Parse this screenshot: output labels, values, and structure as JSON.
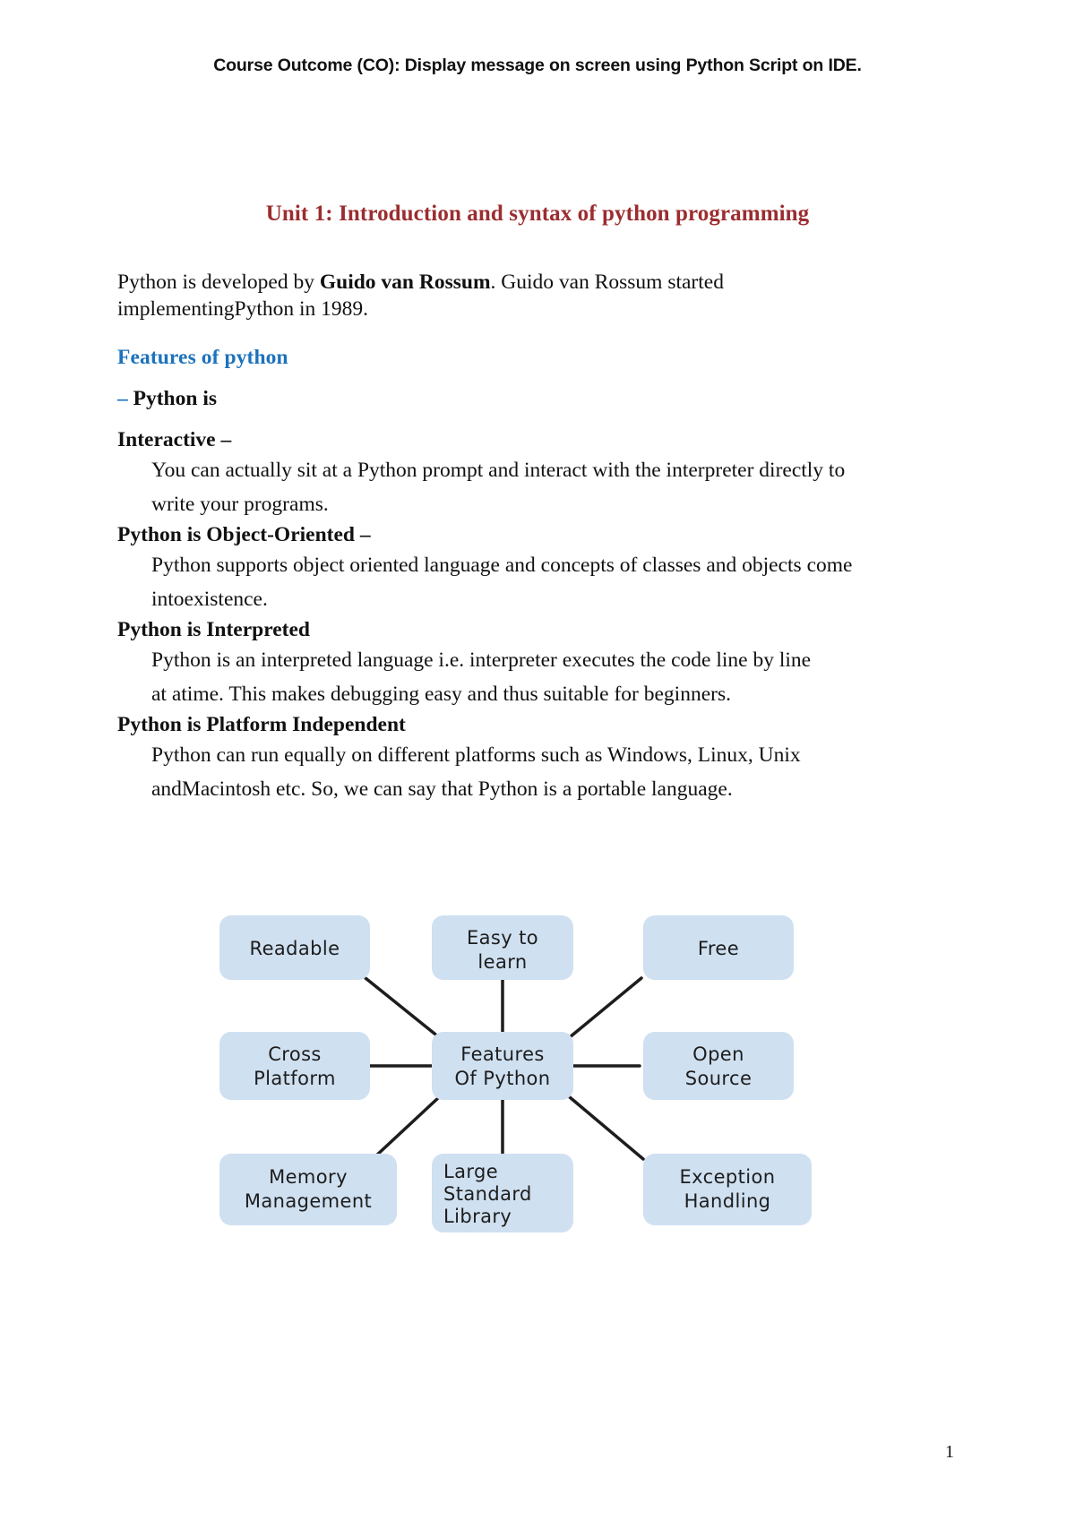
{
  "document": {
    "running_header": "Course Outcome (CO): Display message on screen using Python Script on IDE.",
    "unit_title": "Unit 1: Introduction and syntax of python programming",
    "page_number": "1"
  },
  "colors": {
    "title_red": "#9b2d30",
    "heading_blue": "#1b72bd",
    "node_fill": "#cfe0f1",
    "body_text": "#111111",
    "connector": "#1d1d1d"
  },
  "body": {
    "intro": {
      "line1_before_bold": "Python is developed by ",
      "bold_name": "Guido van Rossum",
      "line1_after_bold": ". Guido van Rossum started",
      "line2": "implementingPython in 1989."
    },
    "features_heading": "Features of python",
    "dash": "– ",
    "python_is": "Python is",
    "sections": [
      {
        "heading": "Interactive –",
        "lines": [
          "You can actually sit at a Python prompt and interact with the interpreter directly to",
          "write your programs."
        ]
      },
      {
        "heading": "Python is Object-Oriented –",
        "lines": [
          "Python supports object oriented language and concepts of classes and objects come",
          "intoexistence."
        ]
      },
      {
        "heading": "Python is Interpreted",
        "lines": [
          "Python is an interpreted language i.e. interpreter executes the code line by line",
          "at atime. This makes debugging easy and thus suitable for beginners."
        ]
      },
      {
        "heading": "Python is Platform Independent",
        "lines": [
          "Python can run equally on different platforms such as Windows, Linux, Unix",
          "andMacintosh  etc. So, we can say that Python is a portable language."
        ]
      }
    ]
  },
  "diagram": {
    "title": "Features Of Python",
    "nodes": {
      "readable": "Readable",
      "easy_to_learn_l1": "Easy to",
      "easy_to_learn_l2": "learn",
      "free": "Free",
      "cross_platform_l1": "Cross",
      "cross_platform_l2": "Platform",
      "center_l1": "Features",
      "center_l2": "Of Python",
      "open_source_l1": "Open",
      "open_source_l2": "Source",
      "memory_management_l1": "Memory",
      "memory_management_l2": "Management",
      "large_std_lib_l1": "Large",
      "large_std_lib_l2": "Standard",
      "large_std_lib_l3": "Library",
      "exception_handling_l1": "Exception",
      "exception_handling_l2": "Handling"
    }
  }
}
